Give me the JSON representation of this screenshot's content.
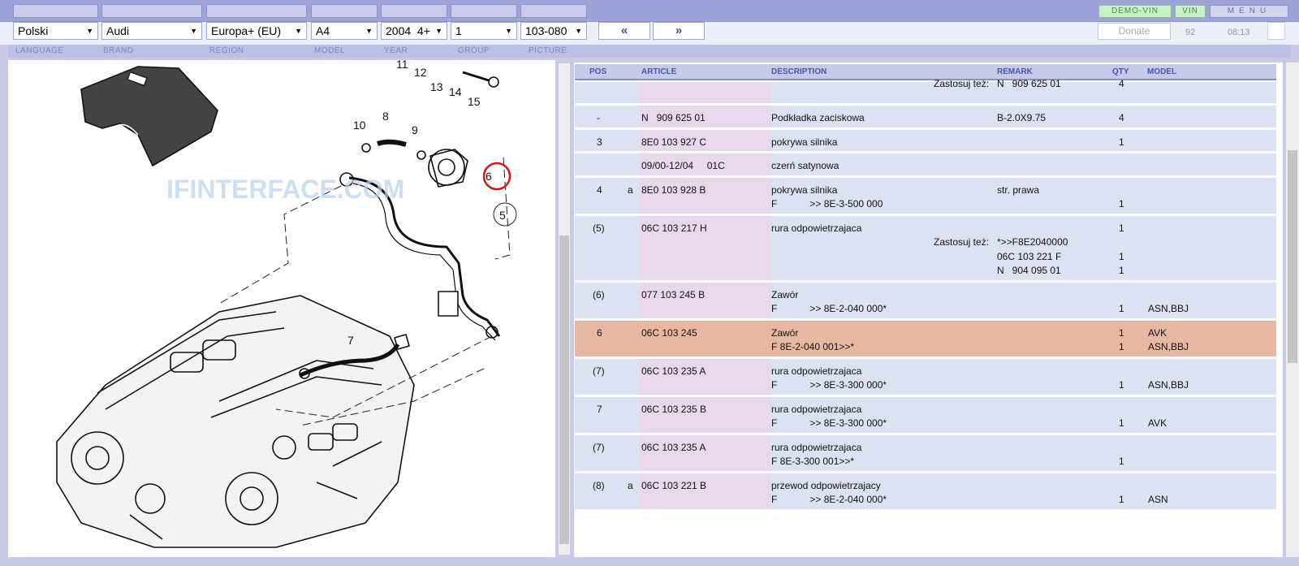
{
  "topbar": {
    "demo_vin": "DEMO-VIN",
    "vin": "VIN",
    "menu": "MENU"
  },
  "selectors": {
    "language": "Polski",
    "brand": "Audi",
    "region": "Europa+ (EU)",
    "model": "A4",
    "year": "2004  4+",
    "group": "1",
    "picture": "103-080",
    "prev": "«",
    "next": "»",
    "donate": "Donate",
    "count": "92",
    "time": "08:13"
  },
  "labels": {
    "language": "LANGUAGE",
    "brand": "BRAND",
    "region": "REGION",
    "model": "MODEL",
    "year": "YEAR",
    "group": "GROUP",
    "picture": "PICTURE"
  },
  "diagram": {
    "watermark": "IFINTERFACE.COM",
    "callouts": [
      "11",
      "12",
      "13",
      "14",
      "15",
      "8",
      "9",
      "10",
      "6",
      "5",
      "7"
    ]
  },
  "table": {
    "headers": {
      "pos": "POS",
      "article": "ARTICLE",
      "description": "DESCRIPTION",
      "remark": "REMARK",
      "qty": "QTY",
      "model": "MODEL"
    },
    "rows": [
      {
        "lines": [
          {
            "zast": "Zastosuj też:",
            "remark": "N   909 625 01",
            "qty": "4"
          }
        ]
      },
      {
        "pos": "-",
        "lines": [
          {
            "article": "N   909 625 01",
            "desc": "Podkładka zaciskowa",
            "remark": "B-2.0X9.75",
            "qty": "4"
          }
        ]
      },
      {
        "pos": "3",
        "lines": [
          {
            "article": "8E0 103 927 C",
            "desc": "pokrywa silnika",
            "qty": "1"
          }
        ]
      },
      {
        "lines": [
          {
            "article": "09/00-12/04     01C",
            "desc": "czerń satynowa"
          }
        ]
      },
      {
        "pos": "4",
        "sub": "a",
        "lines": [
          {
            "article": "8E0 103 928 B",
            "desc": "pokrywa silnika",
            "remark": "str. prawa"
          },
          {
            "desc": "F            >> 8E-3-500 000",
            "qty": "1"
          }
        ]
      },
      {
        "pos": "(5)",
        "lines": [
          {
            "article": "06C 103 217 H",
            "desc": "rura odpowietrzajaca",
            "qty": "1"
          },
          {
            "zast": "Zastosuj też:",
            "remark": "*>>F8E2040000"
          },
          {
            "remark": "06C 103 221 F",
            "qty": "1"
          },
          {
            "remark": "N   904 095 01",
            "qty": "1"
          }
        ]
      },
      {
        "pos": "(6)",
        "lines": [
          {
            "article": "077 103 245 B",
            "desc": "Zawór"
          },
          {
            "desc": "F            >> 8E-2-040 000*",
            "qty": "1",
            "model": "ASN,BBJ"
          }
        ]
      },
      {
        "pos": "6",
        "highlight": true,
        "lines": [
          {
            "article": "06C 103 245",
            "desc": "Zawór",
            "qty": "1",
            "model": "AVK"
          },
          {
            "desc": "F 8E-2-040 001>>*",
            "qty": "1",
            "model": "ASN,BBJ"
          }
        ]
      },
      {
        "pos": "(7)",
        "lines": [
          {
            "article": "06C 103 235 A",
            "desc": "rura odpowietrzajaca"
          },
          {
            "desc": "F            >> 8E-3-300 000*",
            "qty": "1",
            "model": "ASN,BBJ"
          }
        ]
      },
      {
        "pos": "7",
        "lines": [
          {
            "article": "06C 103 235 B",
            "desc": "rura odpowietrzajaca"
          },
          {
            "desc": "F            >> 8E-3-300 000*",
            "qty": "1",
            "model": "AVK"
          }
        ]
      },
      {
        "pos": "(7)",
        "lines": [
          {
            "article": "06C 103 235 A",
            "desc": "rura odpowietrzajaca"
          },
          {
            "desc": "F 8E-3-300 001>>*",
            "qty": "1"
          }
        ]
      },
      {
        "pos": "(8)",
        "sub": "a",
        "lines": [
          {
            "article": "06C 103 221 B",
            "desc": "przewod odpowietrzajacy"
          },
          {
            "desc": "F            >> 8E-2-040 000*",
            "qty": "1",
            "model": "ASN"
          }
        ]
      }
    ]
  }
}
